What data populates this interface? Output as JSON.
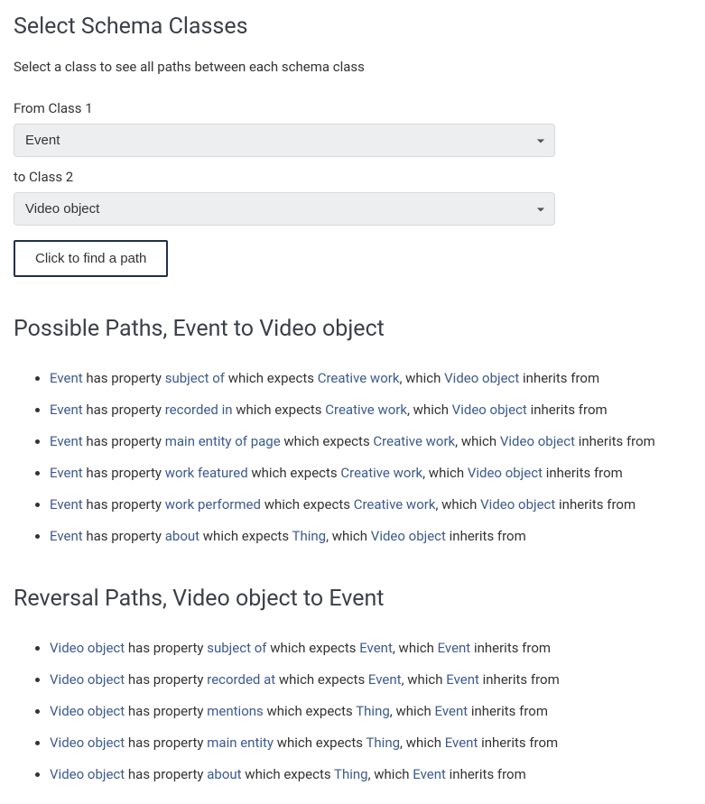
{
  "header": {
    "title": "Select Schema Classes",
    "subtitle": "Select a class to see all paths between each schema class"
  },
  "form": {
    "from_label": "From Class 1",
    "from_value": "Event",
    "to_label": "to Class 2",
    "to_value": "Video object",
    "button_label": "Click to find a path"
  },
  "possible_paths": {
    "heading": "Possible Paths, Event to Video object",
    "items": [
      {
        "source": "Event",
        "property": "subject of",
        "expects": "Creative work",
        "inherits": "Video object"
      },
      {
        "source": "Event",
        "property": "recorded in",
        "expects": "Creative work",
        "inherits": "Video object"
      },
      {
        "source": "Event",
        "property": "main entity of page",
        "expects": "Creative work",
        "inherits": "Video object"
      },
      {
        "source": "Event",
        "property": "work featured",
        "expects": "Creative work",
        "inherits": "Video object"
      },
      {
        "source": "Event",
        "property": "work performed",
        "expects": "Creative work",
        "inherits": "Video object"
      },
      {
        "source": "Event",
        "property": "about",
        "expects": "Thing",
        "inherits": "Video object"
      }
    ]
  },
  "reversal_paths": {
    "heading": "Reversal Paths, Video object to Event",
    "items": [
      {
        "source": "Video object",
        "property": "subject of",
        "expects": "Event",
        "inherits": "Event"
      },
      {
        "source": "Video object",
        "property": "recorded at",
        "expects": "Event",
        "inherits": "Event"
      },
      {
        "source": "Video object",
        "property": "mentions",
        "expects": "Thing",
        "inherits": "Event"
      },
      {
        "source": "Video object",
        "property": "main entity",
        "expects": "Thing",
        "inherits": "Event"
      },
      {
        "source": "Video object",
        "property": "about",
        "expects": "Thing",
        "inherits": "Event"
      }
    ]
  },
  "phrases": {
    "has_property": " has property ",
    "which_expects": " which expects ",
    "comma_which": ", which ",
    "inherits_from": " inherits from"
  }
}
